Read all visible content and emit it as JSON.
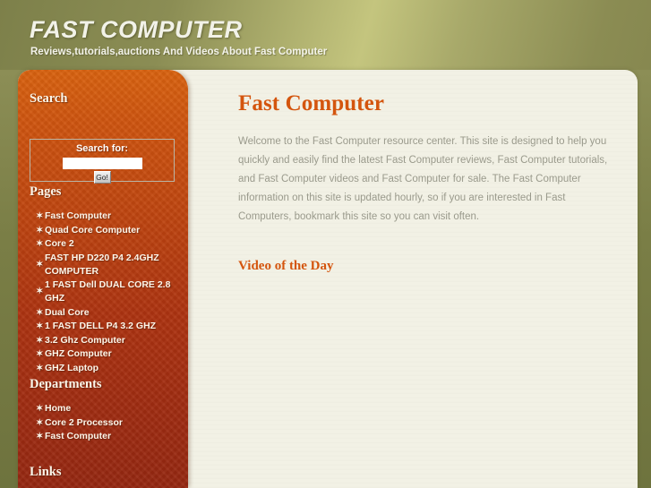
{
  "header": {
    "title": "FAST COMPUTER",
    "tagline": "Reviews,tutorials,auctions And Videos About Fast Computer"
  },
  "sidebar": {
    "search": {
      "heading": "Search",
      "label": "Search for:",
      "input_value": "",
      "placeholder": "",
      "button_label": "Go!"
    },
    "pages": {
      "heading": "Pages",
      "items": [
        "Fast Computer",
        "Quad Core Computer",
        "Core 2",
        "FAST HP D220 P4 2.4GHZ COMPUTER",
        "1 FAST Dell DUAL CORE 2.8 GHZ",
        "Dual Core",
        "1 FAST DELL P4 3.2 GHZ",
        "3.2 Ghz Computer",
        "GHZ Computer",
        "GHZ Laptop"
      ]
    },
    "departments": {
      "heading": "Departments",
      "items": [
        "Home",
        "Core 2 Processor",
        "Fast Computer"
      ]
    },
    "links": {
      "heading": "Links",
      "items": []
    },
    "bullet_glyph": "✶"
  },
  "main": {
    "title": "Fast Computer",
    "paragraph": "Welcome to the Fast Computer resource center. This site is designed to help you quickly and easily find the latest Fast Computer reviews, Fast Computer tutorials, and Fast Computer videos and Fast Computer for sale. The Fast Computer information on this site is updated hourly, so if you are interested in Fast Computers, bookmark this site so you can visit often.",
    "video_heading": "Video of the Day"
  },
  "colors": {
    "header_olive": "#8b8c55",
    "sidebar_orange_top": "#d9620f",
    "sidebar_red_bottom": "#952711",
    "content_cream": "#f2f1e5",
    "accent_orange": "#d4550e",
    "body_text_gray": "#9a9a8c",
    "title_cream": "#f2f2e8"
  }
}
